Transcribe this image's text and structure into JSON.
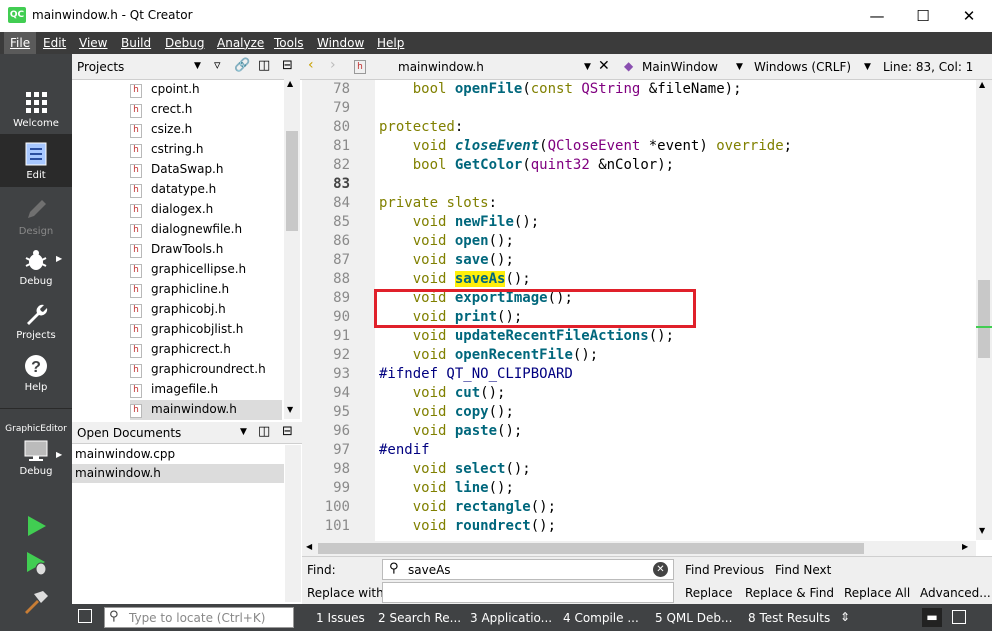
{
  "window": {
    "title": "mainwindow.h - Qt Creator",
    "app_icon": "QC"
  },
  "menu": [
    "File",
    "Edit",
    "View",
    "Build",
    "Debug",
    "Analyze",
    "Tools",
    "Window",
    "Help"
  ],
  "modes": [
    {
      "label": "Welcome",
      "icon": "grid-icon"
    },
    {
      "label": "Edit",
      "icon": "document-icon"
    },
    {
      "label": "Design",
      "icon": "pencil-icon"
    },
    {
      "label": "Debug",
      "icon": "bug-icon"
    },
    {
      "label": "Projects",
      "icon": "wrench-icon"
    },
    {
      "label": "Help",
      "icon": "question-icon"
    }
  ],
  "kit": {
    "project": "GraphicEditor",
    "config": "Debug"
  },
  "projects_panel": {
    "title": "Projects",
    "files": [
      "cpoint.h",
      "crect.h",
      "csize.h",
      "cstring.h",
      "DataSwap.h",
      "datatype.h",
      "dialogex.h",
      "dialognewfile.h",
      "DrawTools.h",
      "graphicellipse.h",
      "graphicline.h",
      "graphicobj.h",
      "graphicobjlist.h",
      "graphicrect.h",
      "graphicroundrect.h",
      "imagefile.h",
      "mainwindow.h"
    ],
    "selected": "mainwindow.h",
    "file_icon_letter": "h"
  },
  "open_documents": {
    "title": "Open Documents",
    "items": [
      "mainwindow.cpp",
      "mainwindow.h"
    ],
    "selected": "mainwindow.h"
  },
  "editor_toolbar": {
    "file": "mainwindow.h",
    "symbol": "MainWindow",
    "line_endings": "Windows (CRLF)",
    "position": "Line: 83, Col: 1"
  },
  "code": {
    "current_line": "83",
    "lines": [
      {
        "n": "78",
        "text": "    bool openFile(const QString &fileName);"
      },
      {
        "n": "79",
        "text": ""
      },
      {
        "n": "80",
        "text": "protected:"
      },
      {
        "n": "81",
        "text": "    void closeEvent(QCloseEvent *event) override;"
      },
      {
        "n": "82",
        "text": "    bool GetColor(quint32 &nColor);"
      },
      {
        "n": "83",
        "text": ""
      },
      {
        "n": "84",
        "text": "private slots:"
      },
      {
        "n": "85",
        "text": "    void newFile();"
      },
      {
        "n": "86",
        "text": "    void open();"
      },
      {
        "n": "87",
        "text": "    void save();"
      },
      {
        "n": "88",
        "text": "    void saveAs();"
      },
      {
        "n": "89",
        "text": "    void exportImage();"
      },
      {
        "n": "90",
        "text": "    void print();"
      },
      {
        "n": "91",
        "text": "    void updateRecentFileActions();"
      },
      {
        "n": "92",
        "text": "    void openRecentFile();"
      },
      {
        "n": "93",
        "text": "#ifndef QT_NO_CLIPBOARD"
      },
      {
        "n": "94",
        "text": "    void cut();"
      },
      {
        "n": "95",
        "text": "    void copy();"
      },
      {
        "n": "96",
        "text": "    void paste();"
      },
      {
        "n": "97",
        "text": "#endif"
      },
      {
        "n": "98",
        "text": "    void select();"
      },
      {
        "n": "99",
        "text": "    void line();"
      },
      {
        "n": "100",
        "text": "    void rectangle();"
      },
      {
        "n": "101",
        "text": "    void roundrect();"
      }
    ]
  },
  "find": {
    "find_label": "Find:",
    "find_value": "saveAs",
    "replace_label": "Replace with:",
    "replace_value": "",
    "buttons": {
      "find_previous": "Find Previous",
      "find_next": "Find Next",
      "replace": "Replace",
      "replace_find": "Replace & Find",
      "replace_all": "Replace All",
      "advanced": "Advanced..."
    }
  },
  "locator": {
    "placeholder": "Type to locate (Ctrl+K)"
  },
  "output_tabs": [
    "1  Issues",
    "2  Search Re...",
    "3  Applicatio...",
    "4  Compile ...",
    "5  QML Deb...",
    "8  Test Results"
  ],
  "colors": {
    "menubar": "#3b3b3b",
    "sidebar": "#404244",
    "keyword": "#808000",
    "function": "#00677c",
    "type": "#800080",
    "search_highlight": "#ffef0b",
    "annotation": "#e0202a",
    "run": "#41cd52"
  }
}
